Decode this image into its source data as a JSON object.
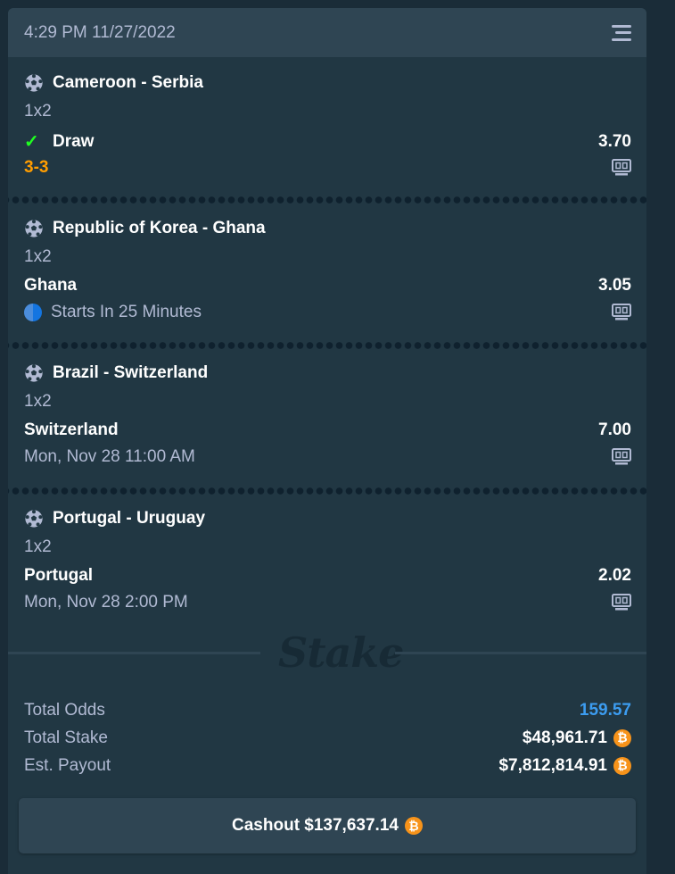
{
  "header": {
    "datetime": "4:29 PM 11/27/2022",
    "menu_icon": "menu-icon"
  },
  "legs": [
    {
      "match": "Cameroon - Serbia",
      "market": "1x2",
      "selection": "Draw",
      "odds": "3.70",
      "info": "3-3",
      "won": true
    },
    {
      "match": "Republic of Korea - Ghana",
      "market": "1x2",
      "selection": "Ghana",
      "odds": "3.05",
      "info": "Starts In 25 Minutes"
    },
    {
      "match": "Brazil - Switzerland",
      "market": "1x2",
      "selection": "Switzerland",
      "odds": "7.00",
      "info": "Mon, Nov 28 11:00 AM"
    },
    {
      "match": "Portugal - Uruguay",
      "market": "1x2",
      "selection": "Portugal",
      "odds": "2.02",
      "info": "Mon, Nov 28 2:00 PM"
    }
  ],
  "brand": "Stake",
  "totals": {
    "total_odds_label": "Total Odds",
    "total_odds": "159.57",
    "total_stake_label": "Total Stake",
    "total_stake": "$48,961.71",
    "payout_label": "Est. Payout",
    "payout": "$7,812,814.91",
    "currency_symbol": "₿"
  },
  "cashout": {
    "label": "Cashout $137,637.14"
  },
  "colors": {
    "background": "#1a2c38",
    "card": "#213743",
    "header": "#2f4553",
    "score": "#ff9d00",
    "odds_blue": "#3c9cf0",
    "check": "#1fff20",
    "btc": "#f7931a"
  }
}
